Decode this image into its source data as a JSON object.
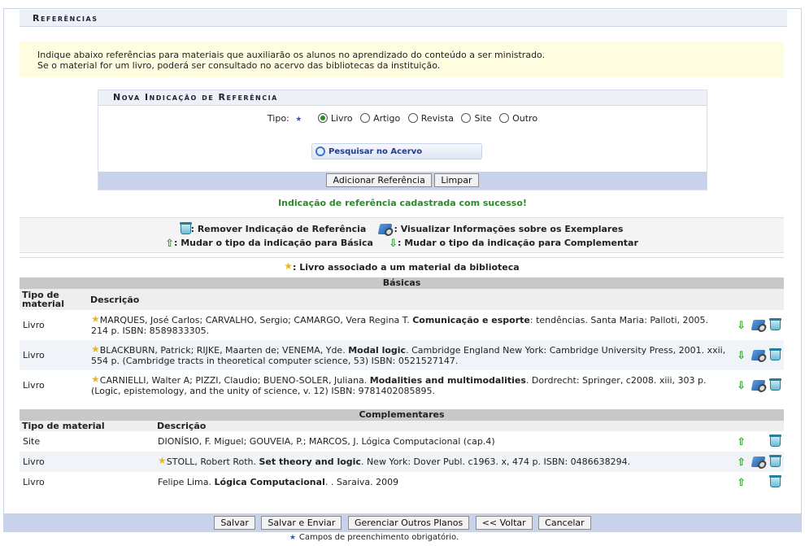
{
  "page": {
    "title": "Referências",
    "info_lines": [
      "Indique abaixo referências para materiais que auxiliarão os alunos no aprendizado do conteúdo a ser ministrado.",
      "Se o material for um livro, poderá ser consultado no acervo das bibliotecas da instituição."
    ]
  },
  "form": {
    "title": "Nova Indicação de Referência",
    "tipo_label": "Tipo:",
    "tipo_options": [
      "Livro",
      "Artigo",
      "Revista",
      "Site",
      "Outro"
    ],
    "tipo_selected": "Livro",
    "search_label": "Pesquisar no Acervo",
    "add_button": "Adicionar Referência",
    "clear_button": "Limpar"
  },
  "success_message": "Indicação de referência cadastrada com sucesso!",
  "legend": {
    "remove": ": Remover Indicação de Referência",
    "view": ": Visualizar Informações sobre os Exemplares",
    "to_basic": ": Mudar o tipo da indicação para Básica",
    "to_complementary": ": Mudar o tipo da indicação para Complementar",
    "library_book": ": Livro associado a um material da biblioteca"
  },
  "basicas": {
    "title": "Básicas",
    "col_type": "Tipo de material",
    "col_desc": "Descrição",
    "rows": [
      {
        "type": "Livro",
        "pre": "MARQUES, José Carlos; CARVALHO, Sergio; CAMARGO, Vera Regina T. ",
        "bold": "Comunicação e esporte",
        "post": ": tendências. Santa Maria: Palloti, 2005. 214 p. ISBN: 8589833305."
      },
      {
        "type": "Livro",
        "pre": "BLACKBURN, Patrick; RIJKE, Maarten de; VENEMA, Yde. ",
        "bold": "Modal logic",
        "post": ". Cambridge England New York: Cambridge University Press, 2001. xxii, 554 p. (Cambridge tracts in theoretical computer science, 53) ISBN: 0521527147."
      },
      {
        "type": "Livro",
        "pre": "CARNIELLI, Walter A; PIZZI, Claudio; BUENO-SOLER, Juliana. ",
        "bold": "Modalities and multimodalities",
        "post": ". Dordrecht: Springer, c2008. xiii, 303 p. (Logic, epistemology, and the unity of science, v. 12) ISBN: 9781402085895."
      }
    ]
  },
  "complementares": {
    "title": "Complementares",
    "col_type": "Tipo de material",
    "col_desc": "Descrição",
    "rows": [
      {
        "type": "Site",
        "pre": "DIONÍSIO, F. Miguel; GOUVEIA, P.; MARCOS, J. Lógica Computacional (cap.4)",
        "bold": "",
        "post": ""
      },
      {
        "type": "Livro",
        "pre": "STOLL, Robert Roth. ",
        "bold": "Set theory and logic",
        "post": ". New York: Dover Publ. c1963. x, 474 p. ISBN: 0486638294."
      },
      {
        "type": "Livro",
        "pre": "Felipe Lima. ",
        "bold": "Lógica Computacional",
        "post": ". . Saraiva. 2009"
      }
    ]
  },
  "footer": {
    "buttons": [
      "Salvar",
      "Salvar e Enviar",
      "Gerenciar Outros Planos",
      "<< Voltar",
      "Cancelar"
    ],
    "required_note": "Campos de preenchimento obrigatório."
  }
}
